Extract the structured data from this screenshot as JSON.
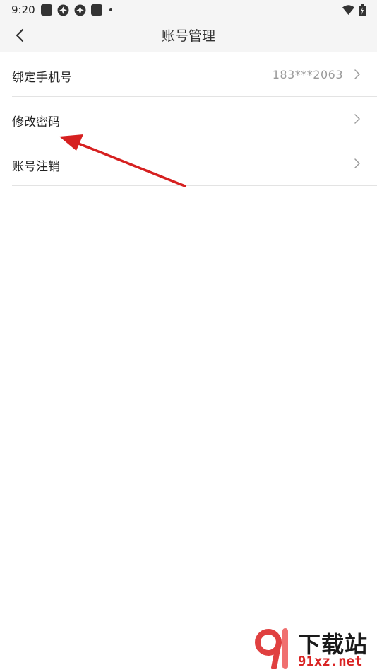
{
  "status_bar": {
    "time": "9:20"
  },
  "header": {
    "title": "账号管理"
  },
  "list": {
    "items": [
      {
        "label": "绑定手机号",
        "value": "183***2063"
      },
      {
        "label": "修改密码",
        "value": ""
      },
      {
        "label": "账号注销",
        "value": ""
      }
    ]
  },
  "watermark": {
    "cn_text": "下载站",
    "domain": "91xz.net"
  },
  "colors": {
    "annotation_arrow": "#d62020",
    "header_bg": "#f5f5f5",
    "value_text": "#9a9a9a"
  }
}
